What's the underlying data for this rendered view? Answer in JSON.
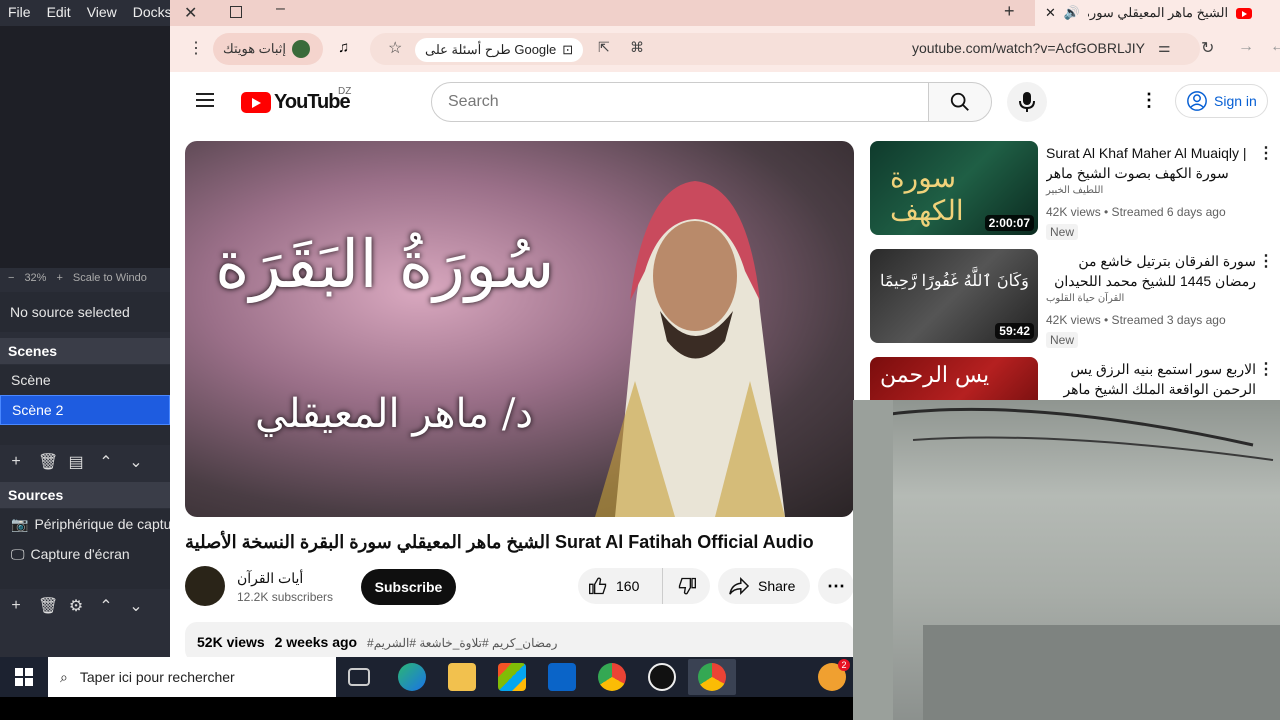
{
  "obs": {
    "menu": [
      "File",
      "Edit",
      "View",
      "Docks"
    ],
    "zoom": "32%",
    "scale_label": "Scale to Windo",
    "no_source": "No source selected",
    "scenes_title": "Scenes",
    "scenes": [
      "Scène",
      "Scène 2"
    ],
    "selected_scene": "Scène 2",
    "sources_title": "Sources",
    "sources": [
      "Périphérique de captu",
      "Capture d'écran"
    ]
  },
  "browser": {
    "tab_title": "الشيخ ماهر المعيقلي سورة ال",
    "profile_pill": "إثبات هويتك",
    "google_pill": "طرح أسئلة على Google",
    "url": "youtube.com/watch?v=AcfGOBRLJIY"
  },
  "youtube": {
    "brand": "YouTube",
    "country": "DZ",
    "search_placeholder": "Search",
    "sign_in": "Sign in",
    "video": {
      "calligraphy_1": "سُورَةُ البَقَرَة",
      "calligraphy_2": "د/ ماهر المعيقلي",
      "title": "الشيخ ماهر المعيقلي سورة البقرة النسخة الأصلية Surat Al Fatihah Official Audio",
      "channel": "أيات القرآن",
      "subscribers": "12.2K subscribers",
      "subscribe": "Subscribe",
      "likes": "160",
      "share": "Share",
      "views": "52K views",
      "age": "2 weeks ago",
      "tags": "#رمضان_كريم #تلاوة_خاشعة #الشريم"
    },
    "recommendations": [
      {
        "title": "Surat Al Khaf Maher Al Muaiqly | سورة الكهف بصوت الشيخ ماهر المعيقلي",
        "channel": "اللطيف الخبير",
        "meta": "42K views • Streamed 6 days ago",
        "badge": "New",
        "duration": "2:00:07"
      },
      {
        "title": "سورة الفرقان بترتيل خاشع من رمضان 1445 للشيخ محمد اللحيدان",
        "channel": "القرآن حياة القلوب",
        "meta": "42K views • Streamed 3 days ago",
        "badge": "New",
        "duration": "59:42"
      },
      {
        "title": "الاربع سور استمع بنيه الرزق يس الرحمن الواقعة الملك الشيخ ماهر المعيقلي 🕋🤲",
        "channel": "",
        "meta": "",
        "badge": "",
        "duration": ""
      }
    ]
  },
  "taskbar": {
    "search_placeholder": "Taper ici pour rechercher",
    "notification_count": "2"
  },
  "colors": {
    "obs_bg": "#2b2e38",
    "obs_selected": "#1e5ce0",
    "chrome_tab": "#f0d0ca",
    "yt_red": "#ff0000",
    "link_blue": "#065fd4"
  }
}
